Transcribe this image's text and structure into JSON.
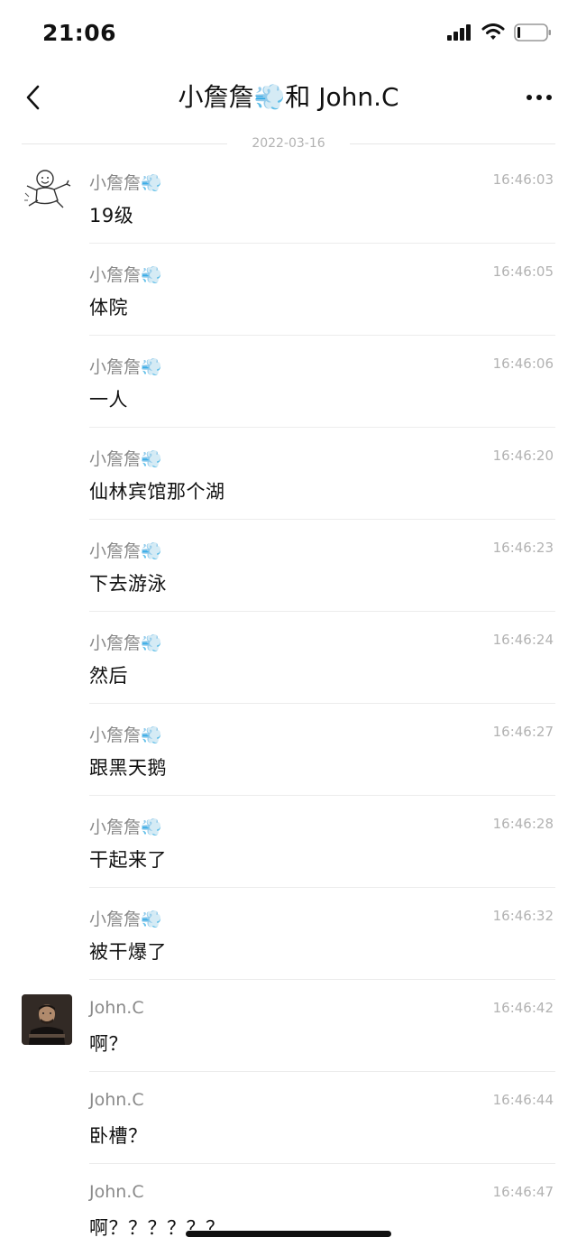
{
  "status_bar": {
    "time": "21:06"
  },
  "nav": {
    "title": "小詹詹💨和 John.C"
  },
  "date_separator": "2022-03-16",
  "messages": [
    {
      "sender": "小詹詹💨",
      "time": "16:46:03",
      "text": "19级"
    },
    {
      "sender": "小詹詹💨",
      "time": "16:46:05",
      "text": "体院"
    },
    {
      "sender": "小詹詹💨",
      "time": "16:46:06",
      "text": "一人"
    },
    {
      "sender": "小詹詹💨",
      "time": "16:46:20",
      "text": "仙林宾馆那个湖"
    },
    {
      "sender": "小詹詹💨",
      "time": "16:46:23",
      "text": "下去游泳"
    },
    {
      "sender": "小詹詹💨",
      "time": "16:46:24",
      "text": "然后"
    },
    {
      "sender": "小詹詹💨",
      "time": "16:46:27",
      "text": "跟黑天鹅"
    },
    {
      "sender": "小詹詹💨",
      "time": "16:46:28",
      "text": "干起来了"
    },
    {
      "sender": "小詹詹💨",
      "time": "16:46:32",
      "text": "被干爆了"
    },
    {
      "sender": "John.C",
      "time": "16:46:42",
      "text": "啊？"
    },
    {
      "sender": "John.C",
      "time": "16:46:44",
      "text": "卧槽？"
    },
    {
      "sender": "John.C",
      "time": "16:46:47",
      "text": "啊？？？？？？"
    }
  ]
}
